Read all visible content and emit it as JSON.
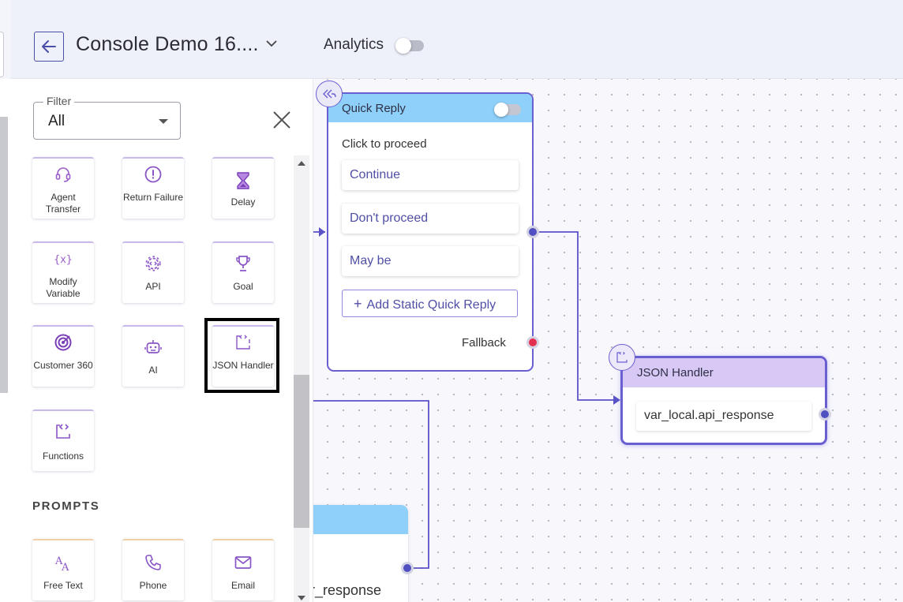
{
  "header": {
    "title": "Console Demo 16....",
    "analytics_label": "Analytics",
    "analytics_enabled": false
  },
  "sidebar": {
    "filter": {
      "label": "Filter",
      "value": "All"
    },
    "tiles": [
      {
        "icon": "headset-icon",
        "label": "Agent Transfer"
      },
      {
        "icon": "alert-circle-icon",
        "label": "Return Failure"
      },
      {
        "icon": "hourglass-icon",
        "label": "Delay"
      },
      {
        "icon": "variable-icon",
        "label": "Modify Variable"
      },
      {
        "icon": "api-gear-icon",
        "label": "API"
      },
      {
        "icon": "trophy-icon",
        "label": "Goal"
      },
      {
        "icon": "target-icon",
        "label": "Customer 360"
      },
      {
        "icon": "robot-icon",
        "label": "AI"
      },
      {
        "icon": "code-bracket-icon",
        "label": "JSON Handler"
      },
      {
        "icon": "functions-icon",
        "label": "Functions"
      }
    ],
    "prompts_section": "PROMPTS",
    "prompt_tiles": [
      {
        "icon": "text-icon",
        "label": "Free Text"
      },
      {
        "icon": "phone-icon",
        "label": "Phone"
      },
      {
        "icon": "email-icon",
        "label": "Email"
      }
    ]
  },
  "canvas": {
    "quick_reply": {
      "title": "Quick Reply",
      "enabled": false,
      "message": "Click to proceed",
      "options": [
        "Continue",
        "Don't proceed",
        "May be"
      ],
      "add_button": "Add Static Quick Reply",
      "fallback": "Fallback"
    },
    "json_handler": {
      "title": "JSON Handler",
      "value": "var_local.api_response"
    },
    "partial_node": {
      "value_fragment": "r_response"
    }
  },
  "colors": {
    "accent": "#6a5fd1",
    "quick_reply_header": "#8ed0fa",
    "json_header": "#d7c8f6",
    "fallback_port": "#e52e4f"
  }
}
